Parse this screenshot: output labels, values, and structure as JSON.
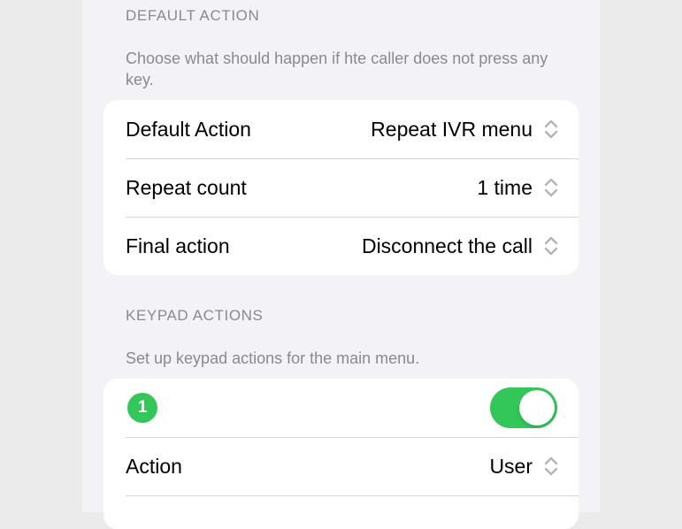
{
  "default_action_section": {
    "header": "DEFAULT ACTION",
    "description": "Choose what should happen if hte caller does not press any key.",
    "rows": [
      {
        "label": "Default Action",
        "value": "Repeat IVR menu"
      },
      {
        "label": "Repeat count",
        "value": "1 time"
      },
      {
        "label": "Final action",
        "value": "Disconnect the call"
      }
    ]
  },
  "keypad_actions_section": {
    "header": "KEYPAD ACTIONS",
    "description": "Set up keypad actions for the main menu.",
    "key_badge": "1",
    "toggle_on": true,
    "rows": [
      {
        "label": "Action",
        "value": "User"
      }
    ]
  },
  "colors": {
    "accent_green": "#33c759",
    "secondary_text": "#8a8a8e",
    "background": "#f2f2f7"
  },
  "icons": {
    "select_indicator": "chevron-up-down-icon"
  }
}
